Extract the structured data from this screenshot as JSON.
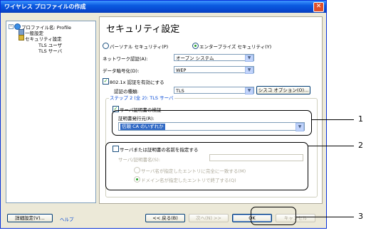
{
  "window": {
    "title": "ワイヤレス プロファイルの作成",
    "close_glyph": "✕"
  },
  "tree": {
    "items": [
      {
        "label": "プロファイル名: Profile"
      },
      {
        "label": "一般設定"
      },
      {
        "label": "セキュリティ設定"
      },
      {
        "label": "TLS ユーザ"
      },
      {
        "label": "TLS サーバ"
      }
    ]
  },
  "panel": {
    "title": "セキュリティ設定",
    "radio_personal": "パーソナル セキュリティ(P)",
    "radio_enterprise": "エンタープライズ セキュリティ(Y)",
    "network_auth_label": "ネットワーク認証(A):",
    "network_auth_value": "オープン システム",
    "encryption_label": "データ暗号化(D):",
    "encryption_value": "WEP",
    "enable_8021x_label": "802.1x 認証を有効にする",
    "auth_type_label": "認証の種類:",
    "auth_type_value": "TLS",
    "cisco_options_button": "シスコ オプション(O)...",
    "step_label": "ステップ 2 (全 2): TLS サーバ",
    "verify_server_cert_label": "サーバ証明書の検証",
    "cert_issuer_label": "証明書発行元(R):",
    "cert_issuer_value": "信頼 CA のいずれか",
    "specify_server_name_label": "サーバまたは証明書の名前を指定する",
    "server_cert_name_label": "サーバ/証明書名(S):",
    "server_cert_name_value": "",
    "match_exact_label": "サーバ名が指定したエントリに完全に一致する(M)",
    "match_domain_label": "ドメイン名が指定したエントリで終了する(Q)"
  },
  "footer": {
    "advanced_button": "詳細設定(V)...",
    "help_link": "ヘルプ",
    "back_button": "<< 戻る(B)",
    "next_button": "次へ(N) >>",
    "ok_button": "OK",
    "cancel_button": "キャンセル"
  },
  "callouts": {
    "one": "1",
    "two": "2",
    "three": "3"
  },
  "colors": {
    "title_bar": "#0848d0",
    "accent_blue": "#0046d5",
    "selection": "#316ac5",
    "callout_line": "#000000"
  }
}
